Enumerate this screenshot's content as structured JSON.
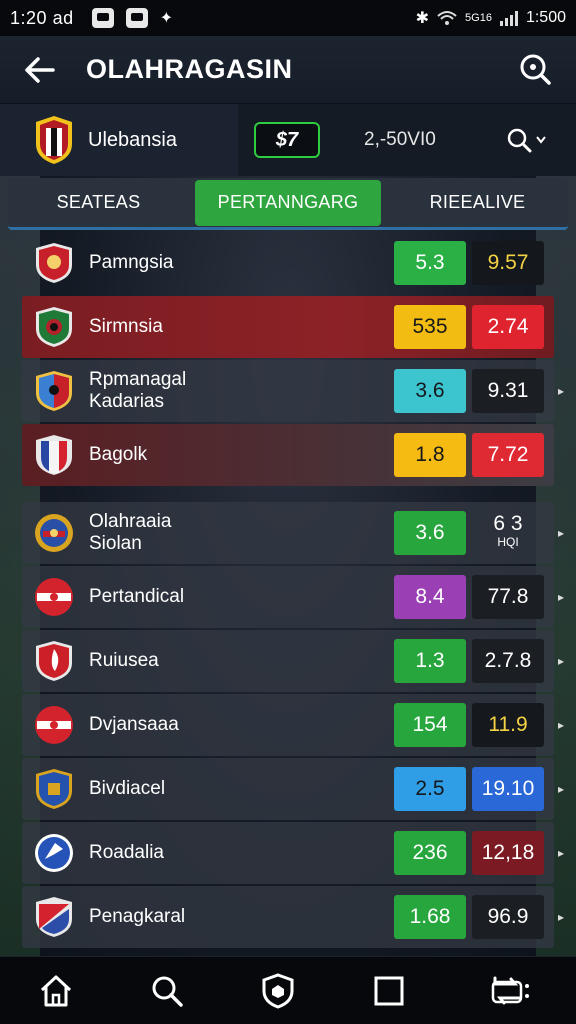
{
  "status_bar": {
    "time": "1:20",
    "suffix": "ad",
    "battery": "1:500",
    "network_text": "5G16"
  },
  "header": {
    "title": "OLAHRAGASIN"
  },
  "team_header": {
    "team_name": "Ulebansia",
    "badge": "$7",
    "value": "2,-50VI0"
  },
  "tabs": [
    {
      "label": "SEATEAS",
      "active": false
    },
    {
      "label": "PERTANNGARG",
      "active": true
    },
    {
      "label": "RIEEALIVE",
      "active": false
    }
  ],
  "rows": [
    {
      "name": "Pamngsia",
      "name2": "",
      "odd1": "5.3",
      "odd1_color": "#2bb046",
      "odd2": "9.57",
      "odd2_color": "#14171b",
      "odd2_text": "#f4d443",
      "style": "first",
      "crest": "crest-red-shield"
    },
    {
      "name": "Sirmnsia",
      "name2": "",
      "odd1": "535",
      "odd1_color": "#f3bc12",
      "odd2": "2.74",
      "odd2_color": "#e0242f",
      "odd2_text": "#ffffff",
      "style": "red",
      "crest": "crest-green-shield"
    },
    {
      "name": "Rpmanagal",
      "name2": "Kadarias",
      "odd1": "3.6",
      "odd1_color": "#3cc4cf",
      "odd2": "9.31",
      "odd2_color": "#1b1e23",
      "odd2_text": "#ffffff",
      "style": "plain",
      "crest": "crest-blue-red-shield"
    },
    {
      "name": "Bagolk",
      "name2": "",
      "odd1": "1.8",
      "odd1_color": "#f6bb12",
      "odd2": "7.72",
      "odd2_color": "#e02a33",
      "odd2_text": "#ffffff",
      "style": "darkred",
      "crest": "crest-tricolor-shield"
    },
    {
      "name": "Olahraaia",
      "name2": "Siolan",
      "odd1": "3.6",
      "odd1_color": "#27a63e",
      "odd2": "6 3",
      "odd2_sub": "HQI",
      "odd2_color": "transparent",
      "odd2_text": "#ffffff",
      "style": "plain",
      "crest": "crest-round-emblem"
    },
    {
      "name": "Pertandical",
      "name2": "",
      "odd1": "8.4",
      "odd1_color": "#9b40b4",
      "odd2": "77.8",
      "odd2_color": "#1b1e23",
      "odd2_text": "#ffffff",
      "style": "plain",
      "crest": "crest-red-white-round"
    },
    {
      "name": "Ruiusea",
      "name2": "",
      "odd1": "1.3",
      "odd1_color": "#27a63e",
      "odd2": "2.7.8",
      "odd2_color": "#1b1e23",
      "odd2_text": "#ffffff",
      "style": "plain",
      "crest": "crest-red-flame-shield"
    },
    {
      "name": "Dvjansaaa",
      "name2": "",
      "odd1": "154",
      "odd1_color": "#27a63e",
      "odd2": "11.9",
      "odd2_color": "#15181c",
      "odd2_text": "#f4d443",
      "style": "plain",
      "crest": "crest-red-white-round"
    },
    {
      "name": "Bivdiacel",
      "name2": "",
      "odd1": "2.5",
      "odd1_color": "#2f9ee6",
      "odd2": "19.10",
      "odd2_color": "#2a68d8",
      "odd2_text": "#ffffff",
      "style": "plain",
      "crest": "crest-blue-gold-shield"
    },
    {
      "name": "Roadalia",
      "name2": "",
      "odd1": "236",
      "odd1_color": "#27a63e",
      "odd2": "12,18",
      "odd2_color": "#7b1a22",
      "odd2_text": "#ffffff",
      "style": "plain",
      "crest": "crest-blue-round"
    },
    {
      "name": "Penagkaral",
      "name2": "",
      "odd1": "1.68",
      "odd1_color": "#27a63e",
      "odd2": "96.9",
      "odd2_color": "#1b1e23",
      "odd2_text": "#ffffff",
      "style": "plain",
      "crest": "crest-red-blue-diagonal"
    }
  ],
  "bottom_nav": [
    "home-icon",
    "search-icon",
    "shield-icon",
    "square-icon",
    "swap-icon"
  ]
}
